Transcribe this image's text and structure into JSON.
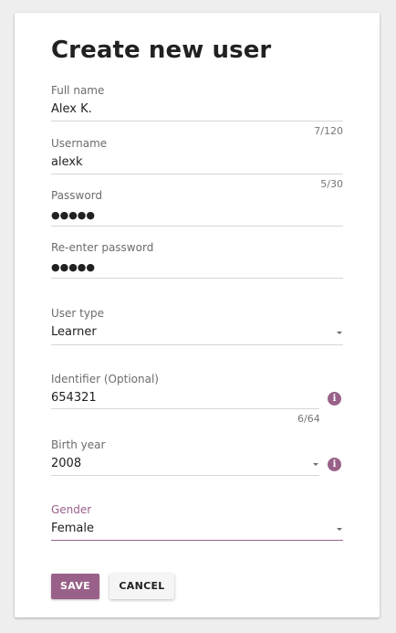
{
  "form": {
    "title": "Create new user",
    "full_name": {
      "label": "Full name",
      "value": "Alex K.",
      "counter": "7/120"
    },
    "username": {
      "label": "Username",
      "value": "alexk",
      "counter": "5/30"
    },
    "password": {
      "label": "Password",
      "value": "●●●●●"
    },
    "reenter_password": {
      "label": "Re-enter password",
      "value": "●●●●●"
    },
    "user_type": {
      "label": "User type",
      "value": "Learner",
      "icon": "chevron-down-icon"
    },
    "identifier": {
      "label": "Identifier (Optional)",
      "value": "654321",
      "counter": "6/64",
      "info_icon": "info-icon",
      "info_glyph": "i"
    },
    "birth_year": {
      "label": "Birth year",
      "value": "2008",
      "icon": "chevron-down-icon",
      "info_icon": "info-icon",
      "info_glyph": "i"
    },
    "gender": {
      "label": "Gender",
      "value": "Female",
      "icon": "chevron-down-icon",
      "active": true
    }
  },
  "actions": {
    "save_label": "SAVE",
    "cancel_label": "CANCEL"
  },
  "colors": {
    "accent": "#996189",
    "background": "#eeeeee",
    "card": "#ffffff",
    "underline": "#d6d6d6"
  }
}
